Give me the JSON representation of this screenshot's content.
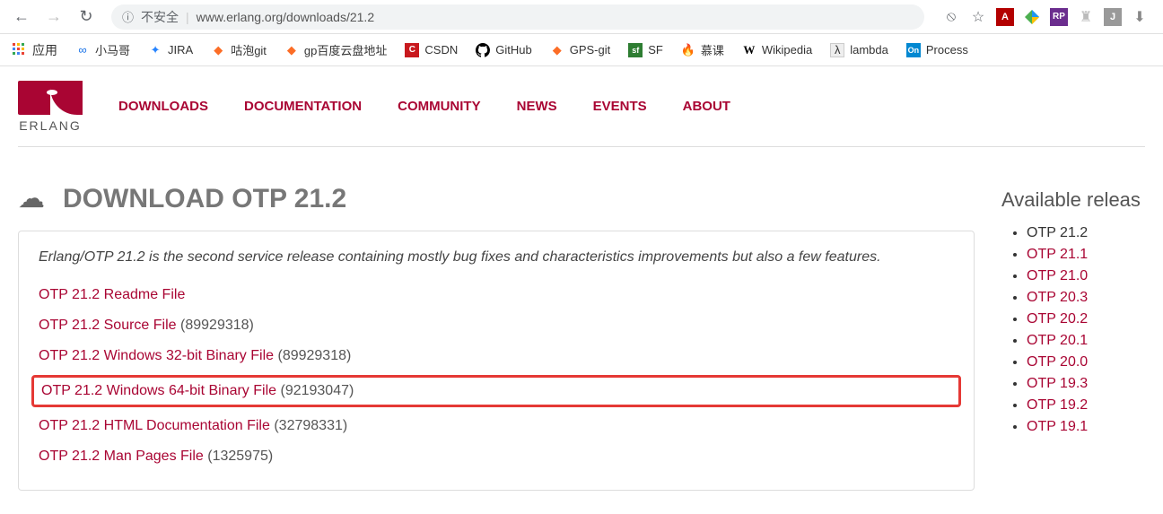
{
  "browser": {
    "url_warning": "不安全",
    "url": "www.erlang.org/downloads/21.2",
    "apps_label": "应用"
  },
  "bookmarks": [
    {
      "icon": "blue-link",
      "label": "小马哥"
    },
    {
      "icon": "jira",
      "label": "JIRA"
    },
    {
      "icon": "gitlab",
      "label": "咕泡git"
    },
    {
      "icon": "gitlab",
      "label": "gp百度云盘地址"
    },
    {
      "icon": "csdn",
      "label": "CSDN"
    },
    {
      "icon": "github",
      "label": "GitHub"
    },
    {
      "icon": "gitlab",
      "label": "GPS-git"
    },
    {
      "icon": "sf",
      "label": "SF"
    },
    {
      "icon": "fire",
      "label": "慕课"
    },
    {
      "icon": "wiki",
      "label": "Wikipedia"
    },
    {
      "icon": "lambda",
      "label": "lambda"
    },
    {
      "icon": "on",
      "label": "Process"
    }
  ],
  "site": {
    "logo_text": "ERLANG",
    "nav": [
      "DOWNLOADS",
      "DOCUMENTATION",
      "COMMUNITY",
      "NEWS",
      "EVENTS",
      "ABOUT"
    ]
  },
  "page": {
    "title": "DOWNLOAD OTP 21.2",
    "description": "Erlang/OTP 21.2 is the second service release containing mostly bug fixes and characteristics improvements but also a few features.",
    "files": [
      {
        "name": "OTP 21.2 Readme File",
        "size": ""
      },
      {
        "name": "OTP 21.2 Source File",
        "size": "(89929318)"
      },
      {
        "name": "OTP 21.2 Windows 32-bit Binary File",
        "size": "(89929318)"
      },
      {
        "name": "OTP 21.2 Windows 64-bit Binary File",
        "size": "(92193047)",
        "highlighted": true
      },
      {
        "name": "OTP 21.2 HTML Documentation File",
        "size": "(32798331)"
      },
      {
        "name": "OTP 21.2 Man Pages File",
        "size": "(1325975)"
      }
    ],
    "sidebar_title": "Available releas",
    "releases": [
      {
        "label": "OTP 21.2",
        "current": true
      },
      {
        "label": "OTP 21.1"
      },
      {
        "label": "OTP 21.0"
      },
      {
        "label": "OTP 20.3"
      },
      {
        "label": "OTP 20.2"
      },
      {
        "label": "OTP 20.1"
      },
      {
        "label": "OTP 20.0"
      },
      {
        "label": "OTP 19.3"
      },
      {
        "label": "OTP 19.2"
      },
      {
        "label": "OTP 19.1"
      }
    ]
  }
}
